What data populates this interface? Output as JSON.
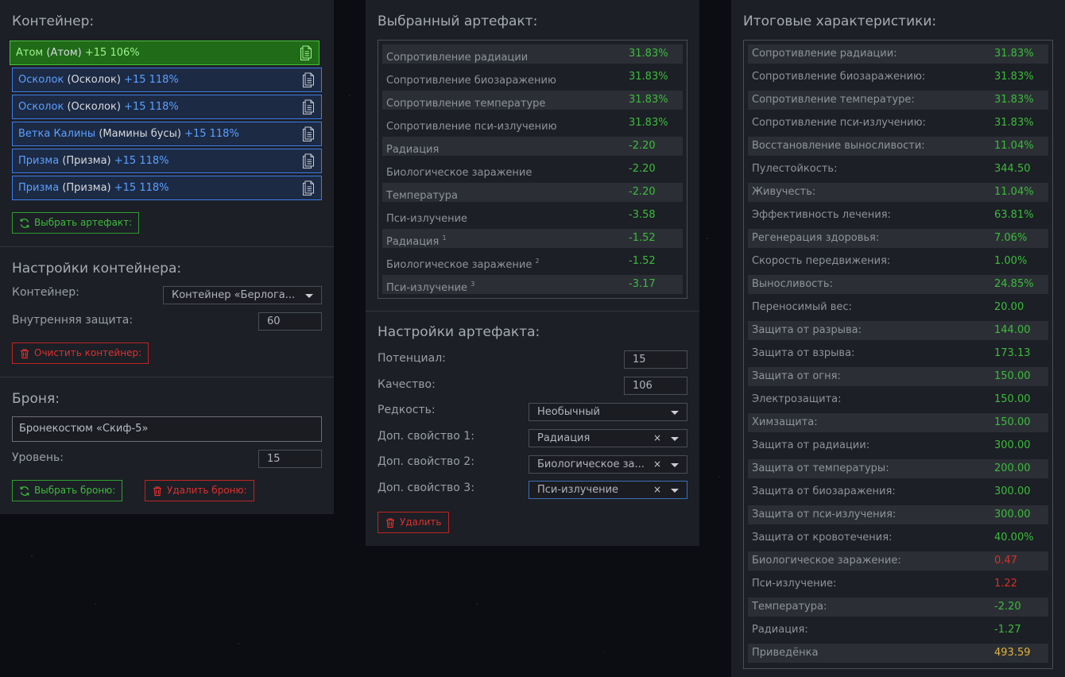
{
  "container": {
    "title": "Контейнер:",
    "slots": [
      {
        "name": "Атом",
        "type": "(Атом)",
        "level": "+15 106%",
        "selected": true
      },
      {
        "name": "Осколок",
        "type": "(Осколок)",
        "level": "+15 118%",
        "selected": false
      },
      {
        "name": "Осколок",
        "type": "(Осколок)",
        "level": "+15 118%",
        "selected": false
      },
      {
        "name": "Ветка Калины",
        "type": "(Мамины бусы)",
        "level": "+15 118%",
        "selected": false
      },
      {
        "name": "Призма",
        "type": "(Призма)",
        "level": "+15 118%",
        "selected": false
      },
      {
        "name": "Призма",
        "type": "(Призма)",
        "level": "+15 118%",
        "selected": false
      }
    ],
    "choose_button": "Выбрать артефакт:"
  },
  "container_settings": {
    "title": "Настройки контейнера:",
    "container_label": "Контейнер:",
    "container_value": "Контейнер «Берлога...",
    "protection_label": "Внутренняя защита:",
    "protection_value": "60",
    "clear_button": "Очистить контейнер:"
  },
  "armor": {
    "title": "Броня:",
    "value": "Бронекостюм «Скиф-5»",
    "level_label": "Уровень:",
    "level_value": "15",
    "choose_button": "Выбрать броню:",
    "delete_button": "Удалить броню:"
  },
  "selected_artifact": {
    "title": "Выбранный артефакт:",
    "stats": [
      {
        "k": "Сопротивление радиации",
        "v": "31.83%",
        "sup": ""
      },
      {
        "k": "Сопротивление биозаражению",
        "v": "31.83%",
        "sup": ""
      },
      {
        "k": "Сопротивление температуре",
        "v": "31.83%",
        "sup": ""
      },
      {
        "k": "Сопротивление пси-излучению",
        "v": "31.83%",
        "sup": ""
      },
      {
        "k": "Радиация",
        "v": "-2.20",
        "sup": ""
      },
      {
        "k": "Биологическое заражение",
        "v": "-2.20",
        "sup": ""
      },
      {
        "k": "Температура",
        "v": "-2.20",
        "sup": ""
      },
      {
        "k": "Пси-излучение",
        "v": "-3.58",
        "sup": ""
      },
      {
        "k": "Радиация",
        "v": "-1.52",
        "sup": "1"
      },
      {
        "k": "Биологическое заражение",
        "v": "-1.52",
        "sup": "2"
      },
      {
        "k": "Пси-излучение",
        "v": "-3.17",
        "sup": "3"
      }
    ]
  },
  "artifact_settings": {
    "title": "Настройки артефакта:",
    "potential_label": "Потенциал:",
    "potential_value": "15",
    "quality_label": "Качество:",
    "quality_value": "106",
    "rarity_label": "Редкость:",
    "rarity_value": "Необычный",
    "prop1_label": "Доп. свойство 1:",
    "prop1_value": "Радиация",
    "prop2_label": "Доп. свойство 2:",
    "prop2_value": "Биологическое за...",
    "prop3_label": "Доп. свойство 3:",
    "prop3_value": "Пси-излучение",
    "clear_symbol": "×",
    "delete_button": "Удалить"
  },
  "totals": {
    "title": "Итоговые характеристики:",
    "stats": [
      {
        "k": "Сопротивление радиации:",
        "v": "31.83%",
        "c": "green"
      },
      {
        "k": "Сопротивление биозаражению:",
        "v": "31.83%",
        "c": "green"
      },
      {
        "k": "Сопротивление температуре:",
        "v": "31.83%",
        "c": "green"
      },
      {
        "k": "Сопротивление пси-излучению:",
        "v": "31.83%",
        "c": "green"
      },
      {
        "k": "Восстановление выносливости:",
        "v": "11.04%",
        "c": "green"
      },
      {
        "k": "Пулестойкость:",
        "v": "344.50",
        "c": "green"
      },
      {
        "k": "Живучесть:",
        "v": "11.04%",
        "c": "green"
      },
      {
        "k": "Эффективность лечения:",
        "v": "63.81%",
        "c": "green"
      },
      {
        "k": "Регенерация здоровья:",
        "v": "7.06%",
        "c": "green"
      },
      {
        "k": "Скорость передвижения:",
        "v": "1.00%",
        "c": "green"
      },
      {
        "k": "Выносливость:",
        "v": "24.85%",
        "c": "green"
      },
      {
        "k": "Переносимый вес:",
        "v": "20.00",
        "c": "green"
      },
      {
        "k": "Защита от разрыва:",
        "v": "144.00",
        "c": "green"
      },
      {
        "k": "Защита от взрыва:",
        "v": "173.13",
        "c": "green"
      },
      {
        "k": "Защита от огня:",
        "v": "150.00",
        "c": "green"
      },
      {
        "k": "Электрозащита:",
        "v": "150.00",
        "c": "green"
      },
      {
        "k": "Химзащита:",
        "v": "150.00",
        "c": "green"
      },
      {
        "k": "Защита от радиации:",
        "v": "300.00",
        "c": "green"
      },
      {
        "k": "Защита от температуры:",
        "v": "200.00",
        "c": "green"
      },
      {
        "k": "Защита от биозаражения:",
        "v": "300.00",
        "c": "green"
      },
      {
        "k": "Защита от пси-излучения:",
        "v": "300.00",
        "c": "green"
      },
      {
        "k": "Защита от кровотечения:",
        "v": "40.00%",
        "c": "green"
      },
      {
        "k": "Биологическое заражение:",
        "v": "0.47",
        "c": "red"
      },
      {
        "k": "Пси-излучение:",
        "v": "1.22",
        "c": "red"
      },
      {
        "k": "Температура:",
        "v": "-2.20",
        "c": "green"
      },
      {
        "k": "Радиация:",
        "v": "-1.27",
        "c": "green"
      },
      {
        "k": "Приведёнка",
        "v": "493.59",
        "c": "gold"
      }
    ]
  },
  "colors": {
    "green": "#3cbb3c",
    "red": "#d9302a",
    "gold": "#e3b13a",
    "blue": "#3e7dea"
  }
}
